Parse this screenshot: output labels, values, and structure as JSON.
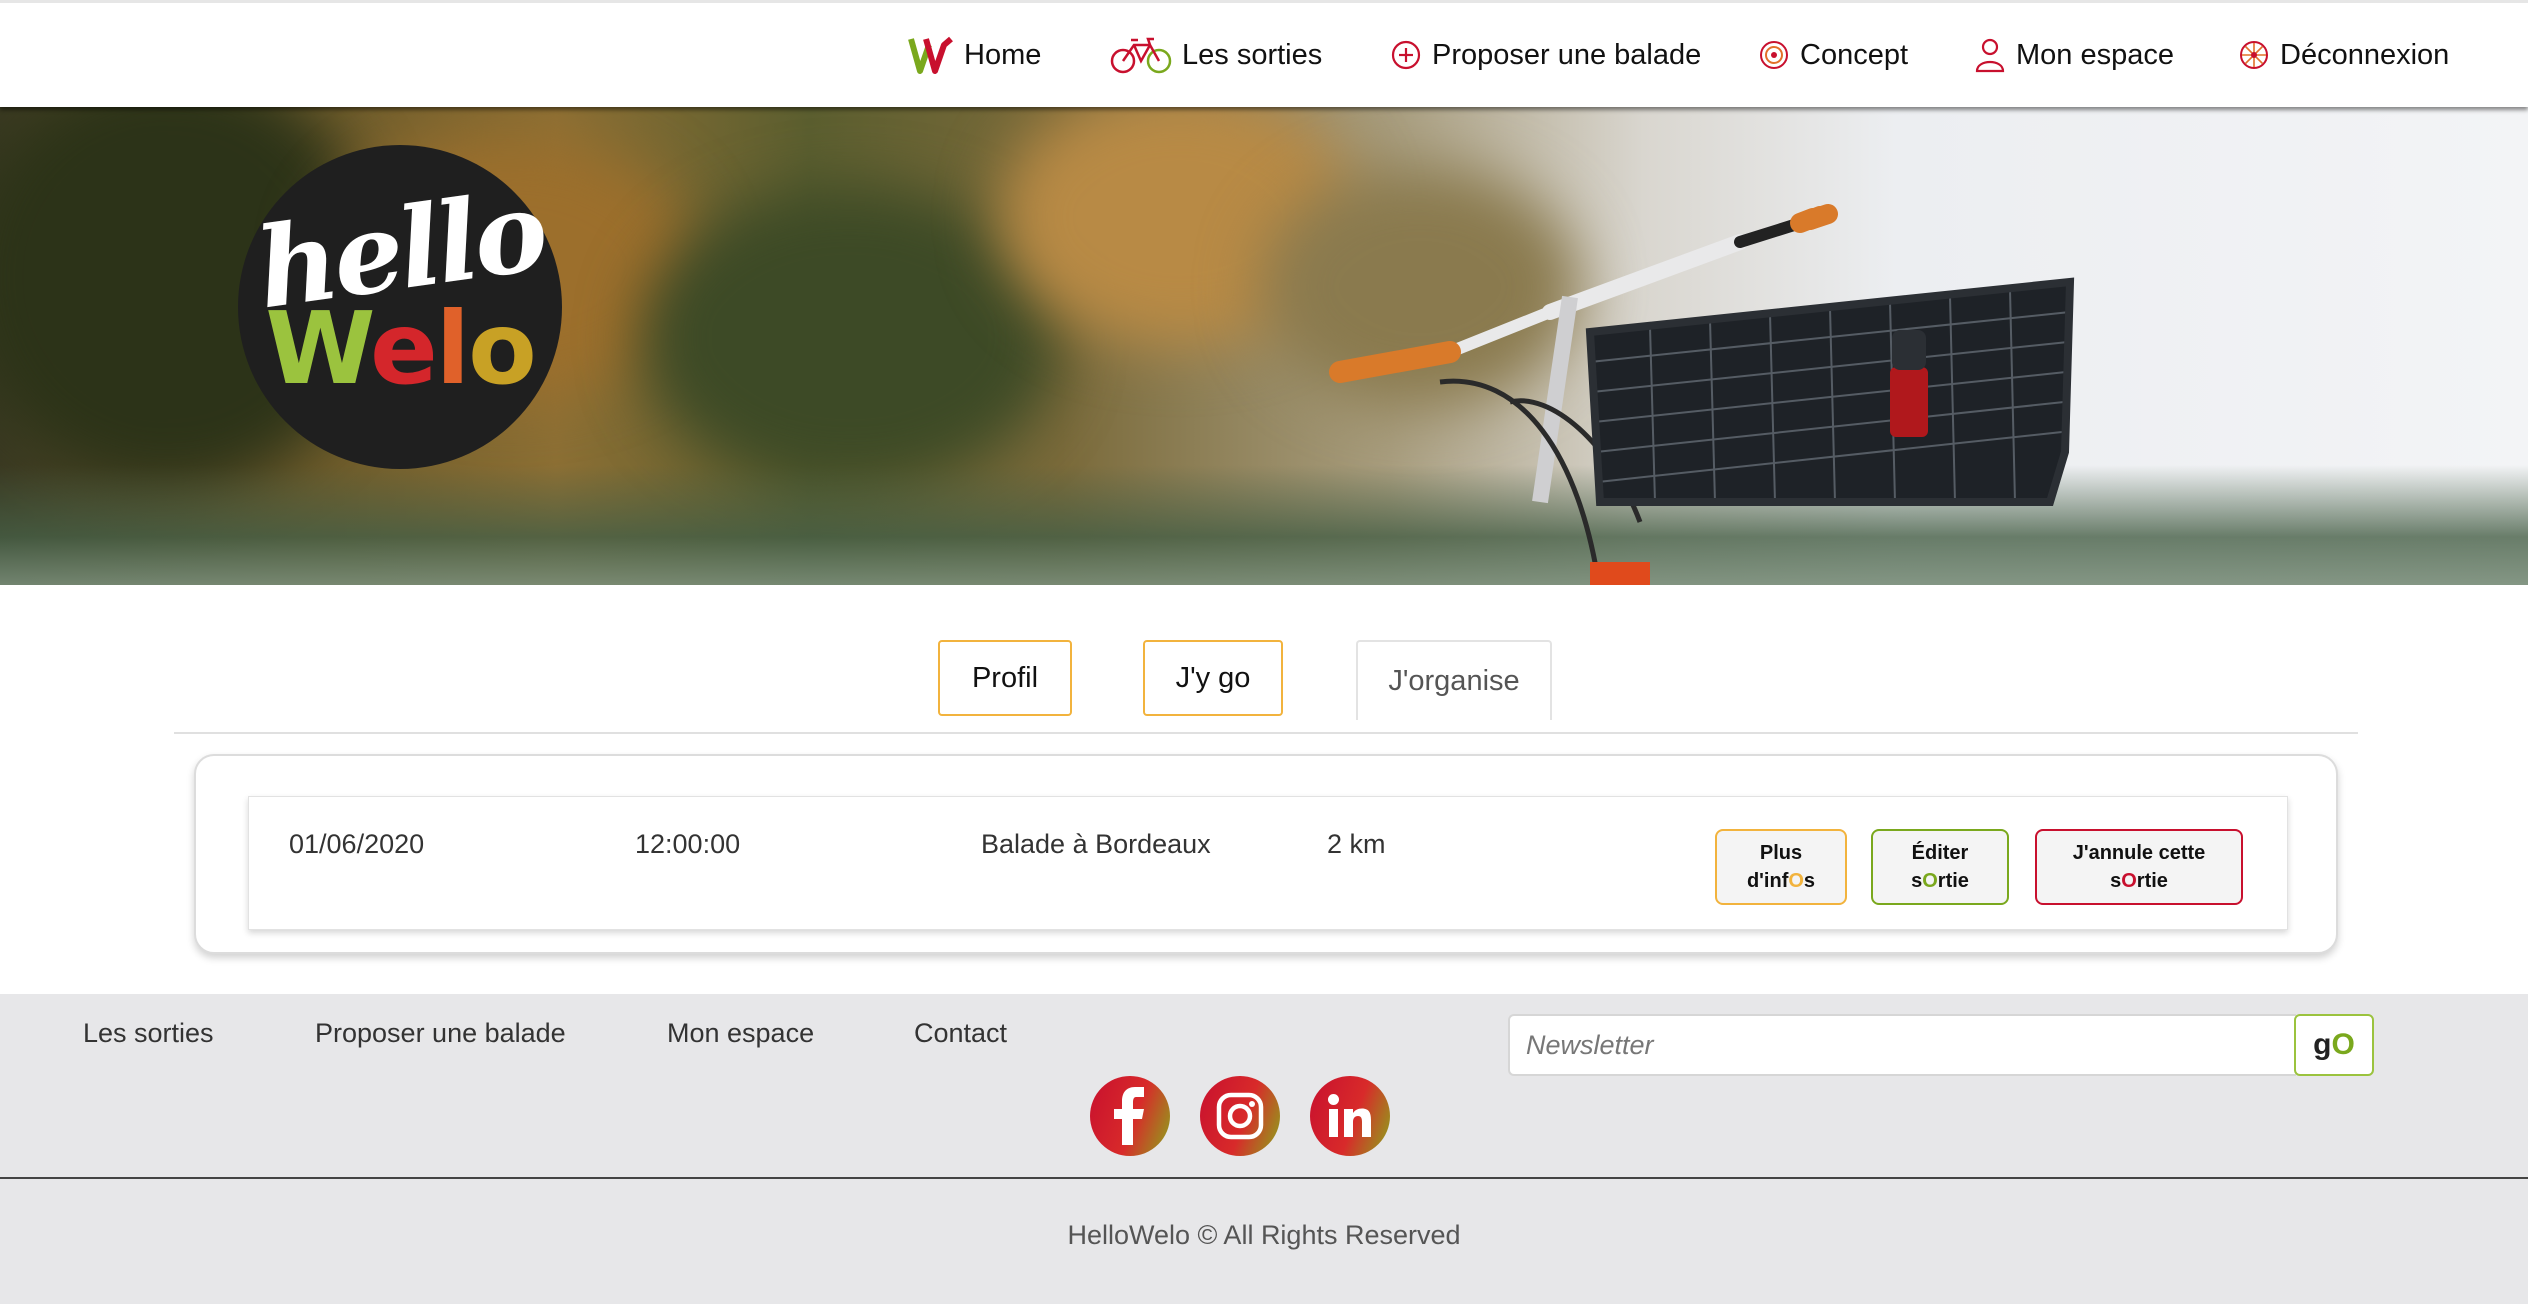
{
  "nav": {
    "items": [
      {
        "label": "Home",
        "icon": "hellowelo-w-icon"
      },
      {
        "label": "Les sorties",
        "icon": "bicycle-icon"
      },
      {
        "label": "Proposer une balade",
        "icon": "plus-circle-icon"
      },
      {
        "label": "Concept",
        "icon": "target-icon"
      },
      {
        "label": "Mon espace",
        "icon": "user-icon"
      },
      {
        "label": "Déconnexion",
        "icon": "logout-wheel-icon"
      }
    ]
  },
  "colors": {
    "red": "#c8102e",
    "green": "#7aa81d",
    "yellow": "#f2b33d",
    "dark": "#1f1f1f"
  },
  "logo": {
    "line1": "hello",
    "line2_letters": [
      "W",
      "e",
      "l",
      "o"
    ]
  },
  "tabs": [
    {
      "label": "Profil"
    },
    {
      "label": "J'y go"
    },
    {
      "label": "J'organise"
    }
  ],
  "outing": {
    "date": "01/06/2020",
    "time": "12:00:00",
    "name": "Balade à Bordeaux",
    "distance": "2 km",
    "buttons": {
      "more_info": {
        "line1": "Plus",
        "line2_a": "d'inf",
        "line2_o": "O",
        "line2_b": "s"
      },
      "edit": {
        "line1": "Éditer",
        "line2_a": "s",
        "line2_o": "O",
        "line2_b": "rtie"
      },
      "cancel": {
        "line1": "J'annule cette",
        "line2_a": "s",
        "line2_o": "O",
        "line2_b": "rtie"
      }
    }
  },
  "footer": {
    "links": [
      "Les sorties",
      "Proposer une balade",
      "Mon espace",
      "Contact"
    ],
    "newsletter_placeholder": "Newsletter",
    "go_g": "g",
    "go_o": "O",
    "social": [
      "facebook-icon",
      "instagram-icon",
      "linkedin-icon"
    ],
    "copyright": "HelloWelo © All Rights Reserved"
  }
}
